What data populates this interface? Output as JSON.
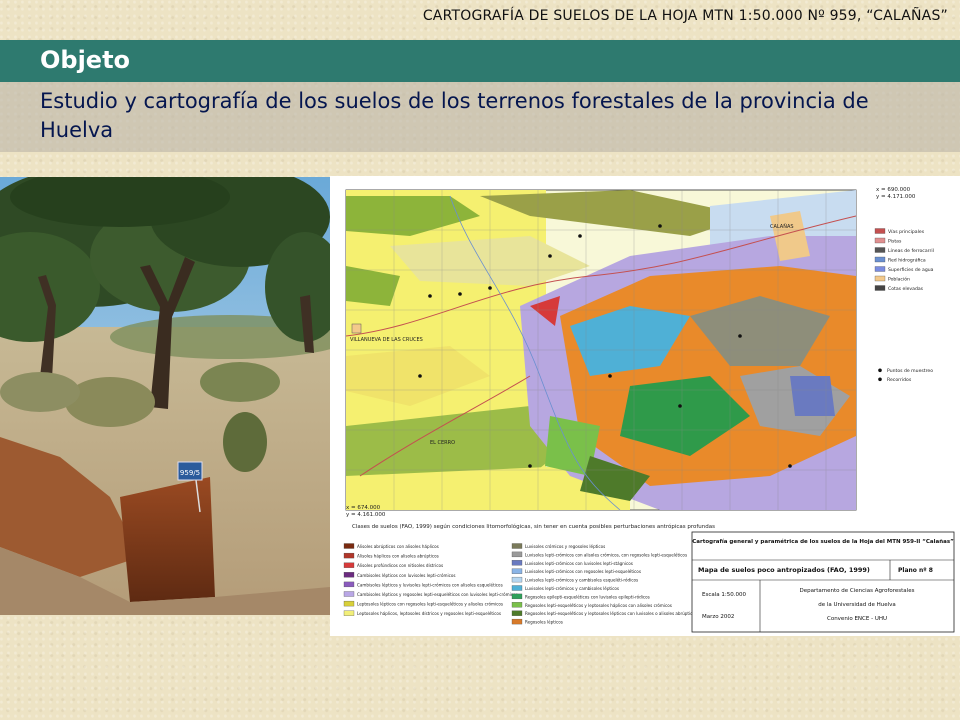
{
  "header": {
    "caption": "CARTOGRAFÍA DE SUELOS DE LA HOJA MTN 1:50.000 Nº 959, “CALAÑAS”"
  },
  "section": {
    "title": "Objeto"
  },
  "description": {
    "text": "Estudio y cartografía de los suelos de los terrenos forestales de la provincia de Huelva"
  },
  "photo": {
    "label": "959/5"
  },
  "map": {
    "coords_top": [
      "x = 690.000",
      "y = 4.171.000"
    ],
    "coords_bottom": [
      "x = 674.000",
      "y = 4.161.000"
    ],
    "places": [
      "VILLANUEVA DE LAS CRUCES",
      "CALAÑAS",
      "EL CERRO"
    ],
    "legend_right": [
      {
        "label": "Vías principales",
        "color": "#c45050"
      },
      {
        "label": "Pistas",
        "color": "#e09090"
      },
      {
        "label": "Líneas de ferrocarril",
        "color": "#555555"
      },
      {
        "label": "Red hidrográfica",
        "color": "#6a8fd0"
      },
      {
        "label": "Superficies de agua",
        "color": "#7a8ce0"
      },
      {
        "label": "Población",
        "color": "#f3c98b"
      },
      {
        "label": "Cotas elevadas",
        "color": "#444444"
      }
    ],
    "legend_right_points": [
      "Puntos de muestreo",
      "Recorridos"
    ],
    "soil_heading": "Clases de suelos (FAO, 1999) según condiciones litomorfológicas, sin tener en cuenta posibles perturbaciones antrópicas profundas",
    "soil_classes_left": [
      {
        "label": "Alisoles abrúpticos con alisoles háplicos",
        "color": "#7a2a10"
      },
      {
        "label": "Alisoles háplicos con alisoles abrúpticos",
        "color": "#b0362a"
      },
      {
        "label": "Alisoles profúndicos con nitisoles dístricos",
        "color": "#d63a3a"
      },
      {
        "label": "Cambisoles lépticos con luvisoles lepti-crómicos",
        "color": "#6b2b80"
      },
      {
        "label": "Cambisoles lépticos y luvisoles lepti-crómicos con alisoles esqueléticos",
        "color": "#8a5bbd"
      },
      {
        "label": "Cambisoles lépticos y regosoles lepti-esqueléticos con luvisoles lepti-crómicos",
        "color": "#b9a7e6"
      },
      {
        "label": "Leptosoles lépticos con regosoles lepti-esqueléticos y alisoles crómicos",
        "color": "#d8d03a"
      },
      {
        "label": "Leptosoles háplicos, leptosoles dístricos y regosoles lepti-esqueléticos",
        "color": "#f2ef7a"
      }
    ],
    "soil_classes_right": [
      {
        "label": "Luvisoles crómicos y regosoles lépticos",
        "color": "#7a7a5a"
      },
      {
        "label": "Luvisoles lepti-crómicos con alisoles crómicos, con regosoles lepti-esqueléticos",
        "color": "#9a9a9a"
      },
      {
        "label": "Luvisoles lepti-crómicos con luvisoles lepti-stágnicos",
        "color": "#6a7ac0"
      },
      {
        "label": "Luvisoles lepti-crómicos con regosoles lepti-esqueléticos",
        "color": "#8ab4e6"
      },
      {
        "label": "Luvisoles lepti-crómicos y cambisoles esqueléti-ródicos",
        "color": "#b6d6f0"
      },
      {
        "label": "Luvisoles lepti-crómicos y cambisoles lépticos",
        "color": "#4fb0d6"
      },
      {
        "label": "Regosoles epilepti-esqueléticos con luvisoles epilepti-ródicos",
        "color": "#2fa05a"
      },
      {
        "label": "Regosoles lepti-esqueléticos y leptosoles háplicos con alisoles crómicos",
        "color": "#7ac04a"
      },
      {
        "label": "Regosoles lepti-esqueléticos y leptosoles lépticos con luvisoles o alisoles abrúpticos",
        "color": "#4e7a2a"
      },
      {
        "label": "Regosoles lépticos",
        "color": "#d77a2a"
      }
    ],
    "title_block": {
      "title": "Cartografía general y paramétrica de los suelos de la Hoja del MTN 959-II “Calañas”",
      "map_name": "Mapa de suelos poco antropizados (FAO, 1999)",
      "plan": "Plano nº 8",
      "scale": "Escala 1:50.000",
      "date": "Marzo 2002",
      "department": "Departamento de Ciencias Agroforestales",
      "university": "de la Universidad de Huelva",
      "agreement": "Convenio ENCE - UHU"
    }
  }
}
